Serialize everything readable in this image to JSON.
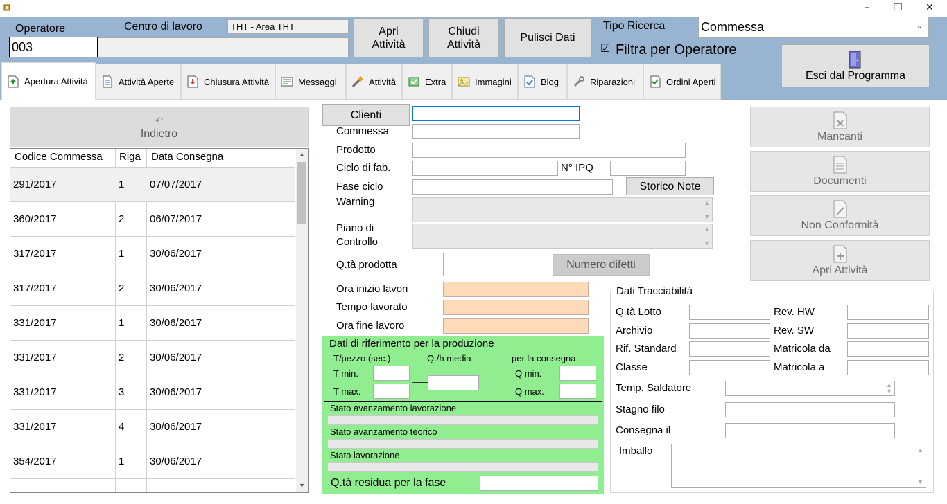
{
  "window": {
    "minimize_label": "–",
    "maximize_label": "❐",
    "close_label": "✕"
  },
  "header": {
    "operatore_label": "Operatore",
    "operatore_value": "003",
    "centro_label": "Centro di lavoro",
    "centro_value": "THT - Area THT",
    "apri_attivita": "Apri\nAttività",
    "chiudi_attivita": "Chiudi\nAttività",
    "pulisci_dati": "Pulisci Dati",
    "tipo_ricerca_label": "Tipo Ricerca",
    "tipo_ricerca_value": "Commessa",
    "filtra_label": "Filtra per Operatore",
    "filtra_checked": "☑",
    "esci_label": "Esci dal Programma"
  },
  "tabs": [
    {
      "label": "Apertura Attività",
      "icon": "upload-doc-icon"
    },
    {
      "label": "Attività Aperte",
      "icon": "document-icon"
    },
    {
      "label": "Chiusura Attività",
      "icon": "download-doc-icon"
    },
    {
      "label": "Messaggi",
      "icon": "message-icon"
    },
    {
      "label": "Attività",
      "icon": "tools-icon"
    },
    {
      "label": "Extra",
      "icon": "extra-icon"
    },
    {
      "label": "Immagini",
      "icon": "images-icon"
    },
    {
      "label": "Blog",
      "icon": "blog-icon"
    },
    {
      "label": "Riparazioni",
      "icon": "wrench-icon"
    },
    {
      "label": "Ordini Aperti",
      "icon": "check-icon"
    }
  ],
  "left": {
    "indietro": "Indietro",
    "columns": [
      "Codice Commessa",
      "Riga",
      "Data Consegna"
    ],
    "rows": [
      [
        "291/2017",
        "1",
        "07/07/2017"
      ],
      [
        "360/2017",
        "2",
        "06/07/2017"
      ],
      [
        "317/2017",
        "1",
        "30/06/2017"
      ],
      [
        "317/2017",
        "2",
        "30/06/2017"
      ],
      [
        "331/2017",
        "1",
        "30/06/2017"
      ],
      [
        "331/2017",
        "2",
        "30/06/2017"
      ],
      [
        "331/2017",
        "3",
        "30/06/2017"
      ],
      [
        "331/2017",
        "4",
        "30/06/2017"
      ],
      [
        "354/2017",
        "1",
        "30/06/2017"
      ]
    ]
  },
  "form": {
    "clienti": "Clienti",
    "commessa": "Commessa",
    "prodotto": "Prodotto",
    "ciclo": "Ciclo di fab.",
    "ipq": "N° IPQ",
    "fase": "Fase ciclo",
    "storico": "Storico Note",
    "warning": "Warning",
    "piano1": "Piano di",
    "piano2": "Controllo",
    "qta_prodotta": "Q.tà prodotta",
    "numero_difetti": "Numero difetti",
    "ora_inizio": "Ora inizio lavori",
    "tempo_lavorato": "Tempo lavorato",
    "ora_fine": "Ora fine lavoro"
  },
  "green": {
    "title": "Dati di riferimento per la produzione",
    "tpezzo": "T/pezzo (sec.)",
    "qh": "Q./h media",
    "consegna": "per la consegna",
    "tmin": "T min.",
    "tmax": "T max.",
    "qmin": "Q min.",
    "qmax": "Q max.",
    "stato_av_lav": "Stato avanzamento lavorazione",
    "stato_av_teo": "Stato avanzamento teorico",
    "stato_lav": "Stato lavorazione",
    "qta_residua": "Q.tà residua per la fase"
  },
  "side_buttons": [
    "Mancanti",
    "Documenti",
    "Non Conformità",
    "Apri Attività"
  ],
  "tracc": {
    "title": "Dati Tracciabilità",
    "qta_lotto": "Q.tà Lotto",
    "rev_hw": "Rev. HW",
    "archivio": "Archivio",
    "rev_sw": "Rev. SW",
    "rif_standard": "Rif. Standard",
    "matricola_da": "Matricola da",
    "classe": "Classe",
    "matricola_a": "Matricola a",
    "temp_saldatore": "Temp. Saldatore",
    "stagno": "Stagno filo",
    "consegna": "Consegna il",
    "imballo": "Imballo"
  },
  "colors": {
    "header": "#99b4d1",
    "green_panel": "#90ee90",
    "peach": "#ffdab9"
  }
}
